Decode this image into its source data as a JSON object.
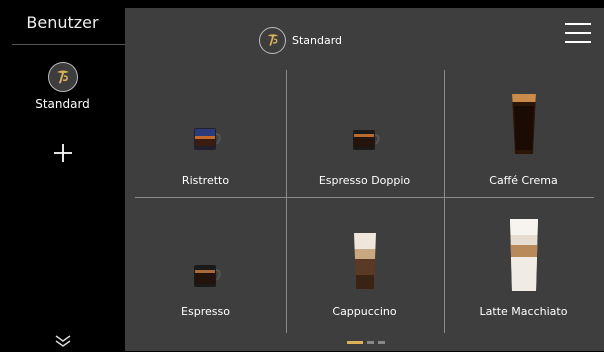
{
  "sidebar": {
    "title": "Benutzer",
    "profile_label": "Standard"
  },
  "header": {
    "title": "Standard"
  },
  "beverages": [
    {
      "label": "Ristretto",
      "icon": "ristretto-cup-icon"
    },
    {
      "label": "Espresso Doppio",
      "icon": "espresso-doppio-cup-icon"
    },
    {
      "label": "Caffé Crema",
      "icon": "caffe-crema-glass-icon"
    },
    {
      "label": "Espresso",
      "icon": "espresso-cup-icon"
    },
    {
      "label": "Cappuccino",
      "icon": "cappuccino-glass-icon"
    },
    {
      "label": "Latte Macchiato",
      "icon": "latte-macchiato-glass-icon"
    }
  ],
  "pager": {
    "current_page": 1,
    "total_pages": 3
  },
  "colors": {
    "accent": "#d9b25a",
    "panel": "#3e3e3e",
    "sidebar": "#000000"
  }
}
